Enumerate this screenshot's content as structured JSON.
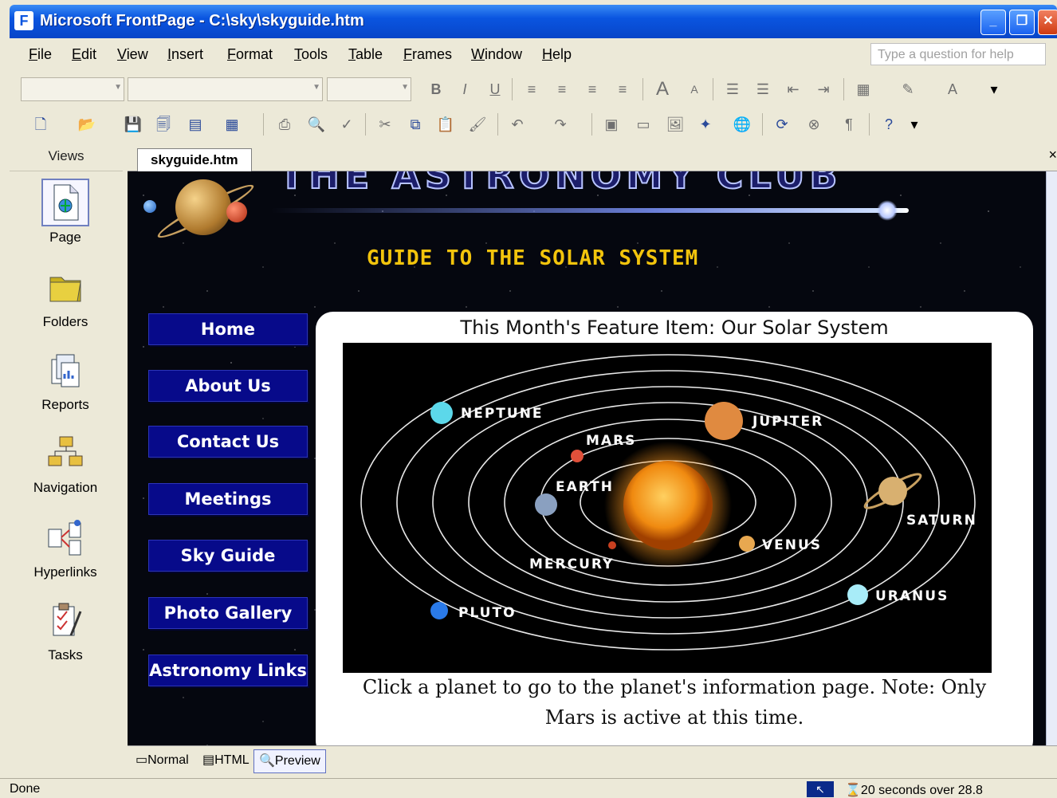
{
  "window": {
    "title": "Microsoft FrontPage - C:\\sky\\skyguide.htm",
    "controls": [
      "_",
      "❐",
      "✕"
    ]
  },
  "menubar": {
    "items": [
      "File",
      "Edit",
      "View",
      "Insert",
      "Format",
      "Tools",
      "Table",
      "Frames",
      "Window",
      "Help"
    ],
    "help_placeholder": "Type a question for help"
  },
  "views": {
    "header": "Views",
    "items": [
      {
        "label": "Page",
        "icon": "page-icon",
        "selected": true
      },
      {
        "label": "Folders",
        "icon": "folder-icon"
      },
      {
        "label": "Reports",
        "icon": "reports-icon"
      },
      {
        "label": "Navigation",
        "icon": "navigation-icon"
      },
      {
        "label": "Hyperlinks",
        "icon": "hyperlinks-icon"
      },
      {
        "label": "Tasks",
        "icon": "tasks-icon"
      }
    ]
  },
  "document": {
    "tab": "skyguide.htm",
    "close": "×"
  },
  "page": {
    "club_banner": "THE ASTRONOMY CLUB",
    "heading": "GUIDE TO THE SOLAR SYSTEM",
    "nav": [
      "Home",
      "About Us",
      "Contact Us",
      "Meetings",
      "Sky Guide",
      "Photo Gallery",
      "Astronomy Links"
    ],
    "feature_title": "This Month's Feature Item: Our Solar System",
    "planets": [
      "NEPTUNE",
      "JUPITER",
      "MARS",
      "EARTH",
      "SATURN",
      "VENUS",
      "MERCURY",
      "URANUS",
      "PLUTO"
    ],
    "caption_line1": "Click a planet to go to the planet's information page. Note: Only",
    "caption_line2": "Mars is active at this time."
  },
  "viewmodes": {
    "items": [
      "Normal",
      "HTML",
      "Preview"
    ],
    "selected": "Preview"
  },
  "status": {
    "text": "Done",
    "download_time": "20 seconds over 28.8"
  },
  "colors": {
    "nav_button": "#070a8a",
    "heading": "#f2c40c",
    "titlebar": "#0a55e0"
  }
}
